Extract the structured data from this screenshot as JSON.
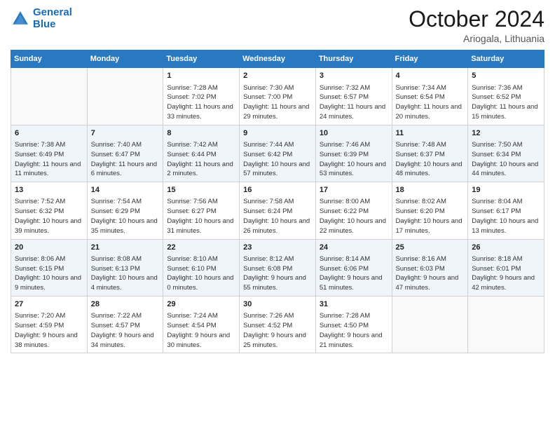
{
  "header": {
    "logo_line1": "General",
    "logo_line2": "Blue",
    "month": "October 2024",
    "location": "Ariogala, Lithuania"
  },
  "weekdays": [
    "Sunday",
    "Monday",
    "Tuesday",
    "Wednesday",
    "Thursday",
    "Friday",
    "Saturday"
  ],
  "weeks": [
    [
      {
        "day": "",
        "sunrise": "",
        "sunset": "",
        "daylight": ""
      },
      {
        "day": "",
        "sunrise": "",
        "sunset": "",
        "daylight": ""
      },
      {
        "day": "1",
        "sunrise": "Sunrise: 7:28 AM",
        "sunset": "Sunset: 7:02 PM",
        "daylight": "Daylight: 11 hours and 33 minutes."
      },
      {
        "day": "2",
        "sunrise": "Sunrise: 7:30 AM",
        "sunset": "Sunset: 7:00 PM",
        "daylight": "Daylight: 11 hours and 29 minutes."
      },
      {
        "day": "3",
        "sunrise": "Sunrise: 7:32 AM",
        "sunset": "Sunset: 6:57 PM",
        "daylight": "Daylight: 11 hours and 24 minutes."
      },
      {
        "day": "4",
        "sunrise": "Sunrise: 7:34 AM",
        "sunset": "Sunset: 6:54 PM",
        "daylight": "Daylight: 11 hours and 20 minutes."
      },
      {
        "day": "5",
        "sunrise": "Sunrise: 7:36 AM",
        "sunset": "Sunset: 6:52 PM",
        "daylight": "Daylight: 11 hours and 15 minutes."
      }
    ],
    [
      {
        "day": "6",
        "sunrise": "Sunrise: 7:38 AM",
        "sunset": "Sunset: 6:49 PM",
        "daylight": "Daylight: 11 hours and 11 minutes."
      },
      {
        "day": "7",
        "sunrise": "Sunrise: 7:40 AM",
        "sunset": "Sunset: 6:47 PM",
        "daylight": "Daylight: 11 hours and 6 minutes."
      },
      {
        "day": "8",
        "sunrise": "Sunrise: 7:42 AM",
        "sunset": "Sunset: 6:44 PM",
        "daylight": "Daylight: 11 hours and 2 minutes."
      },
      {
        "day": "9",
        "sunrise": "Sunrise: 7:44 AM",
        "sunset": "Sunset: 6:42 PM",
        "daylight": "Daylight: 10 hours and 57 minutes."
      },
      {
        "day": "10",
        "sunrise": "Sunrise: 7:46 AM",
        "sunset": "Sunset: 6:39 PM",
        "daylight": "Daylight: 10 hours and 53 minutes."
      },
      {
        "day": "11",
        "sunrise": "Sunrise: 7:48 AM",
        "sunset": "Sunset: 6:37 PM",
        "daylight": "Daylight: 10 hours and 48 minutes."
      },
      {
        "day": "12",
        "sunrise": "Sunrise: 7:50 AM",
        "sunset": "Sunset: 6:34 PM",
        "daylight": "Daylight: 10 hours and 44 minutes."
      }
    ],
    [
      {
        "day": "13",
        "sunrise": "Sunrise: 7:52 AM",
        "sunset": "Sunset: 6:32 PM",
        "daylight": "Daylight: 10 hours and 39 minutes."
      },
      {
        "day": "14",
        "sunrise": "Sunrise: 7:54 AM",
        "sunset": "Sunset: 6:29 PM",
        "daylight": "Daylight: 10 hours and 35 minutes."
      },
      {
        "day": "15",
        "sunrise": "Sunrise: 7:56 AM",
        "sunset": "Sunset: 6:27 PM",
        "daylight": "Daylight: 10 hours and 31 minutes."
      },
      {
        "day": "16",
        "sunrise": "Sunrise: 7:58 AM",
        "sunset": "Sunset: 6:24 PM",
        "daylight": "Daylight: 10 hours and 26 minutes."
      },
      {
        "day": "17",
        "sunrise": "Sunrise: 8:00 AM",
        "sunset": "Sunset: 6:22 PM",
        "daylight": "Daylight: 10 hours and 22 minutes."
      },
      {
        "day": "18",
        "sunrise": "Sunrise: 8:02 AM",
        "sunset": "Sunset: 6:20 PM",
        "daylight": "Daylight: 10 hours and 17 minutes."
      },
      {
        "day": "19",
        "sunrise": "Sunrise: 8:04 AM",
        "sunset": "Sunset: 6:17 PM",
        "daylight": "Daylight: 10 hours and 13 minutes."
      }
    ],
    [
      {
        "day": "20",
        "sunrise": "Sunrise: 8:06 AM",
        "sunset": "Sunset: 6:15 PM",
        "daylight": "Daylight: 10 hours and 9 minutes."
      },
      {
        "day": "21",
        "sunrise": "Sunrise: 8:08 AM",
        "sunset": "Sunset: 6:13 PM",
        "daylight": "Daylight: 10 hours and 4 minutes."
      },
      {
        "day": "22",
        "sunrise": "Sunrise: 8:10 AM",
        "sunset": "Sunset: 6:10 PM",
        "daylight": "Daylight: 10 hours and 0 minutes."
      },
      {
        "day": "23",
        "sunrise": "Sunrise: 8:12 AM",
        "sunset": "Sunset: 6:08 PM",
        "daylight": "Daylight: 9 hours and 55 minutes."
      },
      {
        "day": "24",
        "sunrise": "Sunrise: 8:14 AM",
        "sunset": "Sunset: 6:06 PM",
        "daylight": "Daylight: 9 hours and 51 minutes."
      },
      {
        "day": "25",
        "sunrise": "Sunrise: 8:16 AM",
        "sunset": "Sunset: 6:03 PM",
        "daylight": "Daylight: 9 hours and 47 minutes."
      },
      {
        "day": "26",
        "sunrise": "Sunrise: 8:18 AM",
        "sunset": "Sunset: 6:01 PM",
        "daylight": "Daylight: 9 hours and 42 minutes."
      }
    ],
    [
      {
        "day": "27",
        "sunrise": "Sunrise: 7:20 AM",
        "sunset": "Sunset: 4:59 PM",
        "daylight": "Daylight: 9 hours and 38 minutes."
      },
      {
        "day": "28",
        "sunrise": "Sunrise: 7:22 AM",
        "sunset": "Sunset: 4:57 PM",
        "daylight": "Daylight: 9 hours and 34 minutes."
      },
      {
        "day": "29",
        "sunrise": "Sunrise: 7:24 AM",
        "sunset": "Sunset: 4:54 PM",
        "daylight": "Daylight: 9 hours and 30 minutes."
      },
      {
        "day": "30",
        "sunrise": "Sunrise: 7:26 AM",
        "sunset": "Sunset: 4:52 PM",
        "daylight": "Daylight: 9 hours and 25 minutes."
      },
      {
        "day": "31",
        "sunrise": "Sunrise: 7:28 AM",
        "sunset": "Sunset: 4:50 PM",
        "daylight": "Daylight: 9 hours and 21 minutes."
      },
      {
        "day": "",
        "sunrise": "",
        "sunset": "",
        "daylight": ""
      },
      {
        "day": "",
        "sunrise": "",
        "sunset": "",
        "daylight": ""
      }
    ]
  ]
}
